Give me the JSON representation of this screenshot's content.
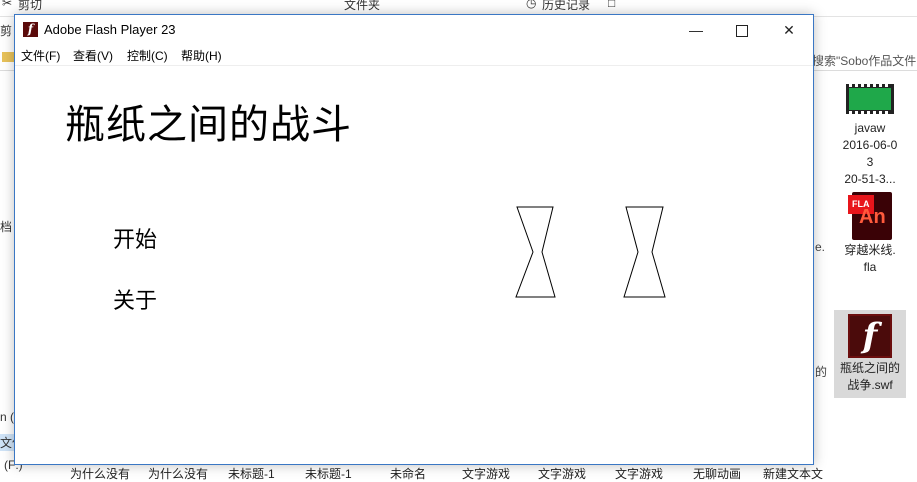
{
  "background": {
    "ribbon": {
      "cut": "剪切",
      "folder": "文件夹",
      "history": "历史记录"
    },
    "left_fragments": [
      "剪",
      "档",
      "n (",
      "文件",
      "(F:)"
    ],
    "search_placeholder": "搜索\"Sobo作品文件",
    "desktop_icons": [
      {
        "name": "javaw-video",
        "label_lines": [
          "javaw",
          "2016-06-0",
          "3",
          "20-51-3..."
        ],
        "icon": "video-icon"
      },
      {
        "name": "fla-file",
        "label_lines": [
          "穿越米线.",
          "fla"
        ],
        "icon": "animate-fla-icon",
        "badge": "FLA",
        "badge_text": "An"
      },
      {
        "name": "swf-file",
        "label_lines": [
          "瓶纸之间的",
          "战争.swf"
        ],
        "icon": "flash-swf-icon",
        "selected": true
      }
    ],
    "partial_right_labels": [
      "e.",
      "的"
    ],
    "bottom_labels": [
      "为什么没有",
      "为什么没有",
      "未标题-1",
      "未标题-1",
      "未命名",
      "文字游戏",
      "文字游戏",
      "文字游戏",
      "无聊动画",
      "新建文本文"
    ]
  },
  "window": {
    "title": "Adobe Flash Player 23",
    "controls": {
      "minimize": "—",
      "close": "✕"
    },
    "menu": [
      "文件(F)",
      "查看(V)",
      "控制(C)",
      "帮助(H)"
    ]
  },
  "stage": {
    "game_title": "瓶纸之间的战斗",
    "options": {
      "start": "开始",
      "about": "关于"
    },
    "bottles": 2
  },
  "colors": {
    "window_border": "#3a77c4",
    "flash_icon_bg": "#5b0a0a",
    "selection": "#d9d9d9",
    "video_icon": "#1fa84a"
  }
}
